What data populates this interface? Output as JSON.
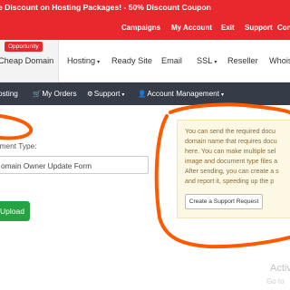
{
  "promo": {
    "text": "e Discount on Hosting Packages! - 50% Discount Coupon"
  },
  "user_links": [
    "Campaigns",
    "My Account",
    "Exit",
    "Support",
    "Cont"
  ],
  "main_nav": {
    "badge": "Opportunity",
    "items": [
      "Cheap Domain",
      "Hosting",
      "Ready Site",
      "Email",
      "SSL",
      "Reseller",
      "Whois"
    ],
    "dropdown_icon": "chevron-down-icon"
  },
  "sub_nav": {
    "items": [
      "osting",
      "My Orders",
      "Support",
      "Account Management"
    ],
    "icons": [
      "cart-icon",
      "gears-icon",
      "user-icon"
    ]
  },
  "form": {
    "label": "ument Type:",
    "select_value": "omain Owner Update Form",
    "upload_label": "Upload"
  },
  "info": {
    "lines": [
      "You can send the required docu",
      "domain name that requires docu",
      "here. You can make multiple sel",
      "image and document type files a",
      "After sending, you can create a s",
      "and report it, speeding up the p"
    ],
    "button_label": "Create a Support Request"
  },
  "watermark": {
    "line1": "Activ",
    "line2": "Go to"
  },
  "colors": {
    "brand_red": "#e8282d",
    "dark_nav": "#353c48",
    "success": "#27a243",
    "annotation": "#ff5a00"
  }
}
